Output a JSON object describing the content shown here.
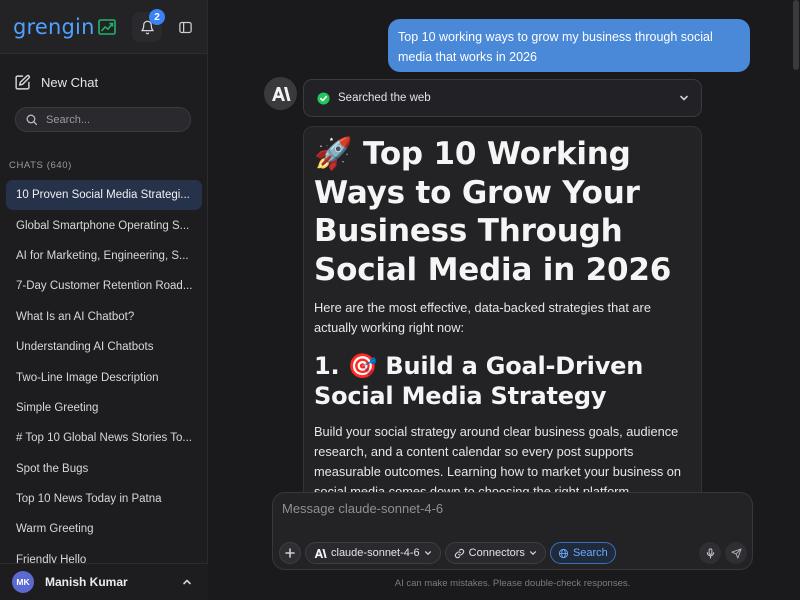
{
  "brand": {
    "name": "grengin",
    "notification_count": "2"
  },
  "sidebar": {
    "new_chat_label": "New Chat",
    "search_placeholder": "Search...",
    "chats_header": "CHATS (640)",
    "chats": [
      "10 Proven Social Media Strategi...",
      "Global Smartphone Operating S...",
      "AI for Marketing, Engineering, S...",
      "7-Day Customer Retention Road...",
      "What Is an AI Chatbot?",
      "Understanding AI Chatbots",
      "Two-Line Image Description",
      "Simple Greeting",
      "# Top 10 Global News Stories To...",
      "Spot the Bugs",
      "Top 10 News Today in Patna",
      "Warm Greeting",
      "Friendly Hello"
    ],
    "active_chat_index": 0
  },
  "user": {
    "initials": "MK",
    "name": "Manish Kumar"
  },
  "conversation": {
    "user_message": "Top 10 working ways to grow my business through social media that works in 2026",
    "search_status": "Searched the web",
    "answer": {
      "title_emoji": "🚀",
      "title": "Top 10 Working Ways to Grow Your Business Through Social Media in 2026",
      "intro": "Here are the most effective, data-backed strategies that are actually working right now:",
      "section1_number": "1.",
      "section1_emoji": "🎯",
      "section1_title": "Build a Goal-Driven Social Media Strategy",
      "section1_body": "Build your social strategy around clear business goals, audience research, and a content calendar so every post supports measurable outcomes. Learning how to market your business on social media comes down to choosing the right platform"
    }
  },
  "composer": {
    "placeholder": "Message claude-sonnet-4-6",
    "model_label": "claude-sonnet-4-6",
    "connectors_label": "Connectors",
    "search_label": "Search",
    "disclaimer": "AI can make mistakes. Please double-check responses."
  },
  "colors": {
    "accent": "#4a88d8",
    "brand_blue": "#4ea1ff",
    "active_chat_bg": "#26324a",
    "check_green": "#22c55e",
    "avatar_purple": "#5b6ad0"
  }
}
